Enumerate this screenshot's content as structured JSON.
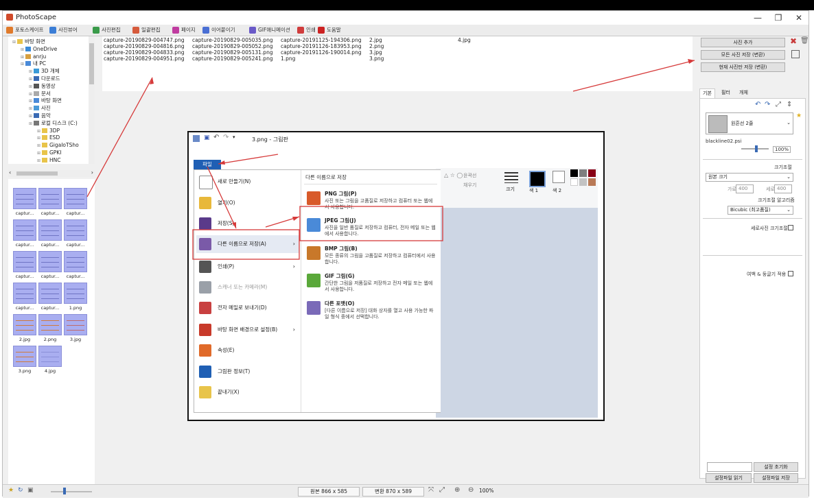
{
  "app": {
    "title": "PhotoScape"
  },
  "window_controls": {
    "minimize": "—",
    "restore": "❐",
    "close": "✕"
  },
  "tabs": [
    {
      "label": "포토스케이프",
      "color": "#e07a2a"
    },
    {
      "label": "사진뷰어",
      "color": "#3c7ed6"
    },
    {
      "label": "사진편집",
      "color": "#3a9b4a"
    },
    {
      "label": "일괄편집",
      "color": "#d65b3c"
    },
    {
      "label": "페이지",
      "color": "#c03ca0"
    },
    {
      "label": "이어붙이기",
      "color": "#4a6fd4"
    },
    {
      "label": "GIF애니메이션",
      "color": "#6a5ac8"
    },
    {
      "label": "인쇄",
      "color": "#d03c3c"
    },
    {
      "label": "도움말",
      "color": "#cc2222"
    }
  ],
  "tree": [
    {
      "label": "바탕 화면",
      "indent": 0,
      "icon": "folder-icon"
    },
    {
      "label": "OneDrive",
      "indent": 1,
      "icon": "cloud-icon"
    },
    {
      "label": "anrju",
      "indent": 1,
      "icon": "user-icon"
    },
    {
      "label": "내 PC",
      "indent": 1,
      "icon": "pc-icon"
    },
    {
      "label": "3D 개체",
      "indent": 2,
      "icon": "cube-icon"
    },
    {
      "label": "다운로드",
      "indent": 2,
      "icon": "download-icon"
    },
    {
      "label": "동영상",
      "indent": 2,
      "icon": "video-icon"
    },
    {
      "label": "문서",
      "indent": 2,
      "icon": "document-icon"
    },
    {
      "label": "바탕 화면",
      "indent": 2,
      "icon": "desktop-icon"
    },
    {
      "label": "사진",
      "indent": 2,
      "icon": "picture-icon"
    },
    {
      "label": "음악",
      "indent": 2,
      "icon": "music-icon"
    },
    {
      "label": "로컬 디스크 (C:)",
      "indent": 2,
      "icon": "drive-icon"
    },
    {
      "label": "3DP",
      "indent": 3,
      "icon": "folder-icon"
    },
    {
      "label": "ESD",
      "indent": 3,
      "icon": "folder-icon"
    },
    {
      "label": "GigaIoTSho",
      "indent": 3,
      "icon": "folder-icon"
    },
    {
      "label": "GPKI",
      "indent": 3,
      "icon": "folder-icon"
    },
    {
      "label": "HNC",
      "indent": 3,
      "icon": "folder-icon"
    }
  ],
  "thumbnails": [
    "captur...",
    "captur...",
    "captur...",
    "captur...",
    "captur...",
    "captur...",
    "captur...",
    "captur...",
    "captur...",
    "captur...",
    "captur...",
    "1.png",
    "2.jpg",
    "2.png",
    "3.jpg",
    "3.png",
    "4.jpg"
  ],
  "file_columns": [
    [
      "capture-20190829-004747.png",
      "capture-20190829-004816.png",
      "capture-20190829-004833.png",
      "capture-20190829-004951.png"
    ],
    [
      "capture-20190829-005035.png",
      "capture-20190829-005052.png",
      "capture-20190829-005131.png",
      "capture-20190829-005241.png"
    ],
    [
      "capture-20191125-194306.png",
      "capture-20191126-183953.png",
      "capture-20191126-190014.png",
      "1.png"
    ],
    [
      "2.jpg",
      "2.png",
      "3.jpg",
      "3.png"
    ],
    [
      "4.jpg"
    ]
  ],
  "paint": {
    "title": "3.png - 그림판",
    "file_tab": "파일",
    "menu_left": [
      {
        "label": "새로 만들기(N)",
        "icon": "new-file-icon",
        "color": "#ffffff",
        "arrow": ""
      },
      {
        "label": "열기(O)",
        "icon": "open-folder-icon",
        "color": "#e8b83a",
        "arrow": ""
      },
      {
        "label": "저장(S)",
        "icon": "save-disk-icon",
        "color": "#5a3a8a",
        "arrow": ""
      },
      {
        "label": "다른 이름으로 저장(A)",
        "icon": "save-as-icon",
        "color": "#7a5aa8",
        "arrow": "›"
      },
      {
        "label": "인쇄(P)",
        "icon": "print-icon",
        "color": "#555555",
        "arrow": "›"
      },
      {
        "label": "스캐너 또는 카메라(M)",
        "icon": "scanner-icon",
        "color": "#9aa0a8",
        "arrow": ""
      },
      {
        "label": "전자 메일로 보내기(D)",
        "icon": "mail-icon",
        "color": "#c84040",
        "arrow": ""
      },
      {
        "label": "바탕 화면 배경으로 설정(B)",
        "icon": "desktop-background-icon",
        "color": "#c83a2a",
        "arrow": "›"
      },
      {
        "label": "속성(E)",
        "icon": "check-icon",
        "color": "#e06a2a",
        "arrow": ""
      },
      {
        "label": "그림판 정보(T)",
        "icon": "info-icon",
        "color": "#1f5fb4",
        "arrow": ""
      },
      {
        "label": "끝내기(X)",
        "icon": "exit-icon",
        "color": "#e8c44a",
        "arrow": ""
      }
    ],
    "submenu_title": "다른 이름으로 저장",
    "formats": [
      {
        "title": "PNG 그림(P)",
        "desc": "사진 또는 그림을 고품질로 저장하고 컴퓨터 또는 웹에서 사용합니다.",
        "icon": "png-icon",
        "color": "#d85a2a"
      },
      {
        "title": "JPEG 그림(J)",
        "desc": "사진을 일반 품질로 저장하고 컴퓨터, 전자 메일 또는 웹에서 사용합니다.",
        "icon": "jpeg-icon",
        "color": "#4a8ad8"
      },
      {
        "title": "BMP 그림(B)",
        "desc": "모든 종류의 그림을 고품질로 저장하고 컴퓨터에서 사용합니다.",
        "icon": "bmp-icon",
        "color": "#c8782a"
      },
      {
        "title": "GIF 그림(G)",
        "desc": "간단한 그림을 저품질로 저장하고 전자 메일 또는 웹에서 사용합니다.",
        "icon": "gif-icon",
        "color": "#5aa83a"
      },
      {
        "title": "다른 포맷(O)",
        "desc": "[다른 이름으로 저장] 대화 상자를 열고 사용 가능한 파일 형식 중에서 선택합니다.",
        "icon": "other-format-icon",
        "color": "#7a6ab8"
      }
    ],
    "ribbon": {
      "outline": "윤곽선",
      "fill": "채우기",
      "size": "크기",
      "color1": "색 1",
      "color2": "색 2"
    }
  },
  "right_panel": {
    "add_photo": "사진 추가",
    "save_all": "모든 사진 저장 (변환)",
    "save_current": "현재 사진만 저장 (변환)",
    "tabs": [
      "기본",
      "필터",
      "개체"
    ],
    "frame_name": "원흔선 2줄",
    "frame_file": "blackline02.psi",
    "zoom": "100%",
    "resize_label": "크기조절",
    "resize_mode": "원본 크기",
    "width_label": "가로",
    "width_value": "400",
    "height_label": "세로",
    "height_value": "400",
    "algo_label": "크기조절 알고리즘",
    "algo_value": "Bicubic (최고품질)",
    "portrait_label": "세로사진 크기조절",
    "margin_label": "여백 & 둥글기 적용",
    "reset": "설정 초기화",
    "load": "설정파일 읽기",
    "save": "설정파일 저장"
  },
  "status": {
    "original": "원본 866 x 585",
    "converted": "변환 870 x 589",
    "zoom": "100%"
  },
  "colors": {
    "accent": "#1f5fb4",
    "highlight": "#d63a3a",
    "thumb": "#a9aef0"
  }
}
